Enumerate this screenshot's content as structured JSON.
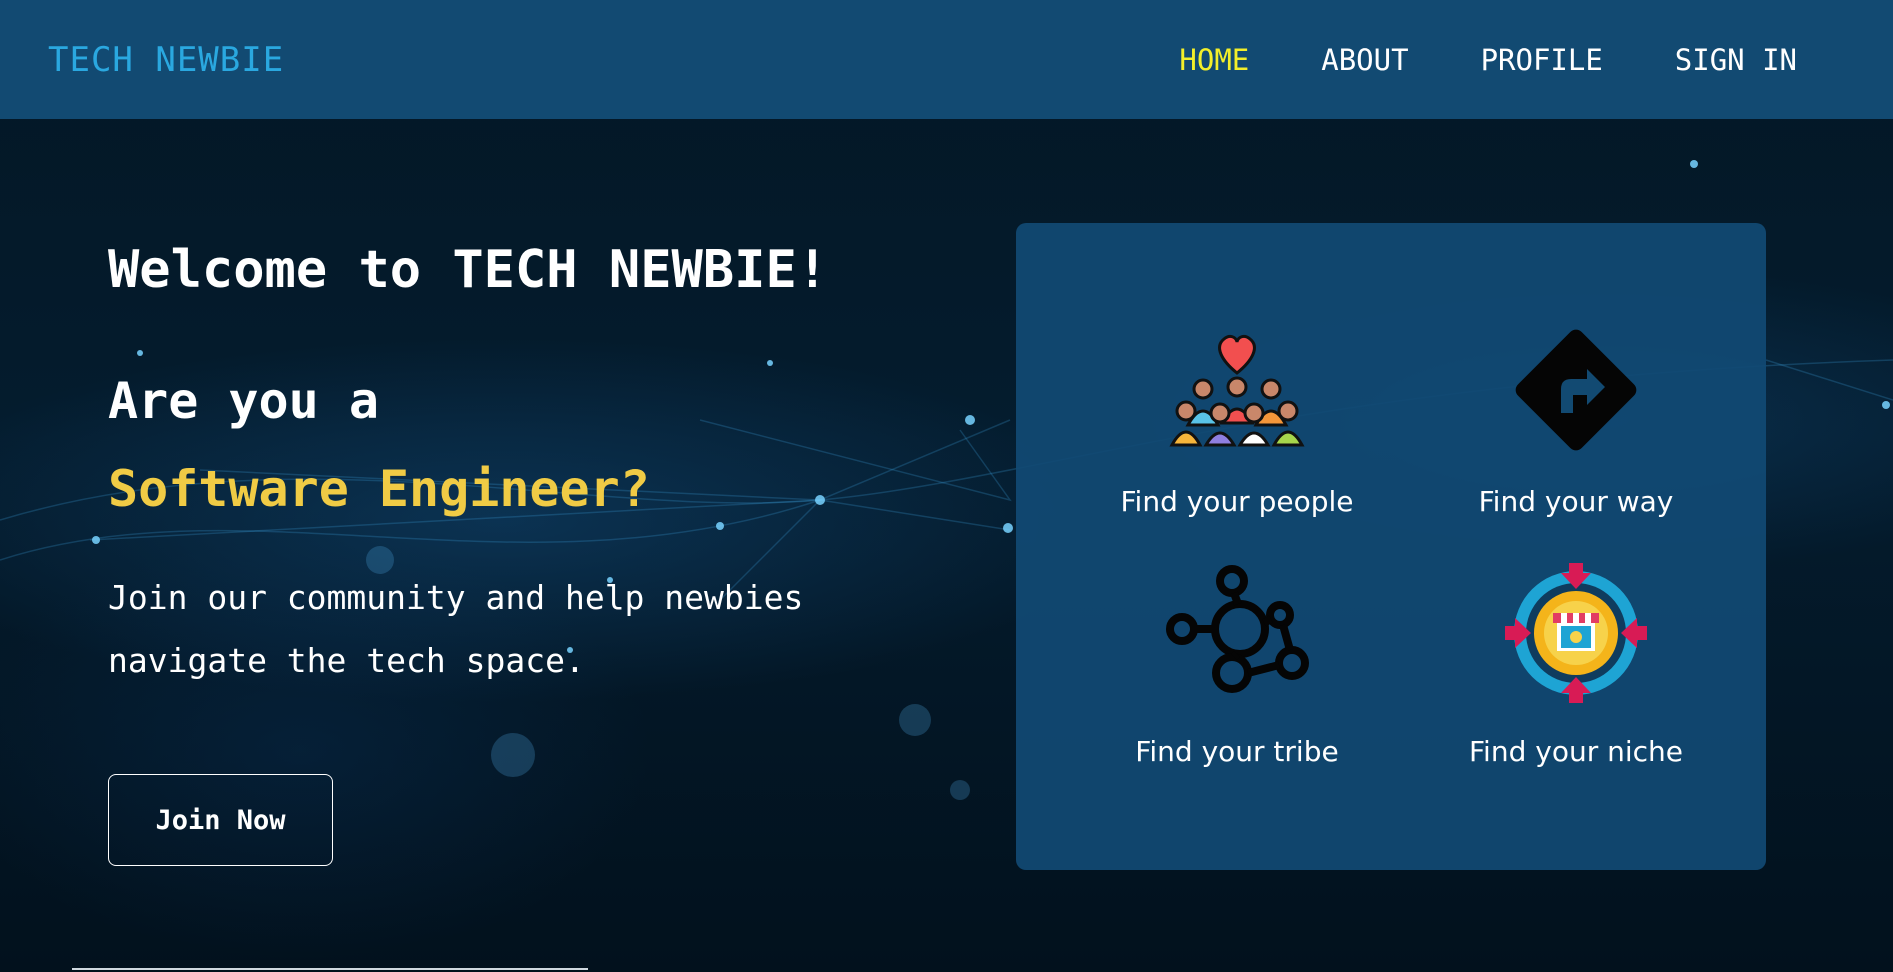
{
  "nav": {
    "brand": "TECH NEWBIE",
    "links": [
      {
        "label": "HOME",
        "active": true
      },
      {
        "label": "ABOUT",
        "active": false
      },
      {
        "label": "PROFILE",
        "active": false
      },
      {
        "label": "SIGN IN",
        "active": false
      }
    ],
    "colors": {
      "bar": "#124a72",
      "brand": "#2aa8e0",
      "active": "#f2ef2a"
    }
  },
  "hero": {
    "welcome": "Welcome to TECH NEWBIE!",
    "ask": "Are you a",
    "role": "Software Engineer?",
    "description": "Join our community and help newbies navigate the tech space.",
    "cta_label": "Join Now",
    "colors": {
      "role": "#f0cb45"
    }
  },
  "features": [
    {
      "label": "Find your people",
      "icon": "people-heart-icon"
    },
    {
      "label": "Find your way",
      "icon": "direction-sign-icon"
    },
    {
      "label": "Find your tribe",
      "icon": "network-nodes-icon"
    },
    {
      "label": "Find your niche",
      "icon": "target-shop-icon"
    }
  ]
}
